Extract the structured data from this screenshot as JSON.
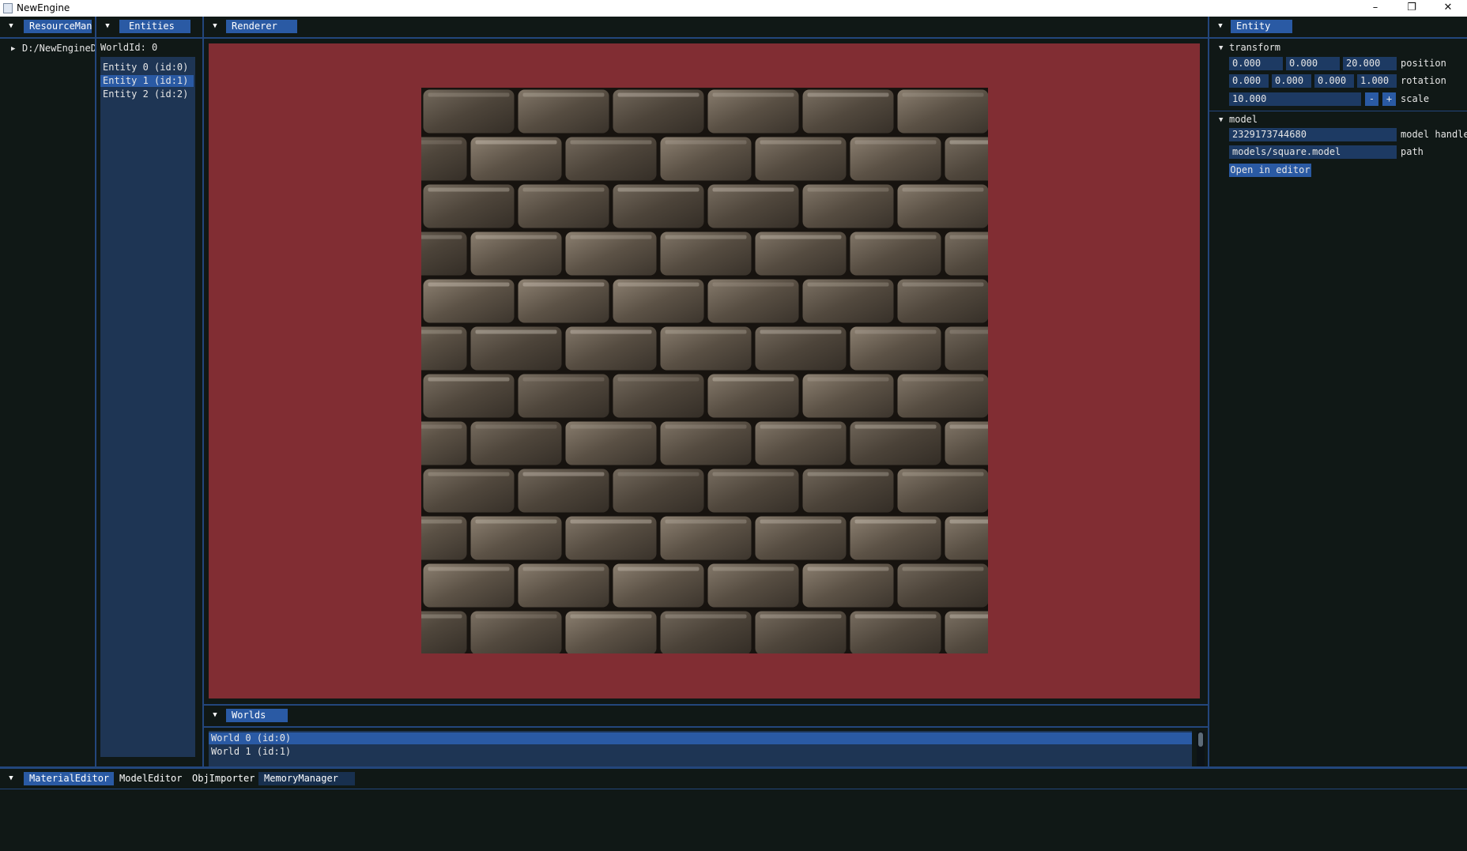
{
  "window": {
    "title": "NewEngine",
    "min": "–",
    "max": "❐",
    "close": "✕"
  },
  "resource_panel": {
    "tab": "ResourceMan",
    "tree_root": "D:/NewEngineD"
  },
  "entities_panel": {
    "tab": "Entities",
    "world_id": "WorldId: 0",
    "items": [
      "Entity 0 (id:0)",
      "Entity 1 (id:1)",
      "Entity 2 (id:2)"
    ],
    "selected": 1
  },
  "renderer_panel": {
    "tab": "Renderer",
    "clear_color": "#812d33",
    "texture": "stone-brick-wall"
  },
  "worlds_panel": {
    "tab": "Worlds",
    "items": [
      "World 0 (id:0)",
      "World 1 (id:1)"
    ],
    "selected": 0
  },
  "entity_panel": {
    "tab": "Entity",
    "transform": {
      "header": "transform",
      "position": [
        "0.000",
        "0.000",
        "20.000"
      ],
      "position_label": "position",
      "rotation": [
        "0.000",
        "0.000",
        "0.000",
        "1.000"
      ],
      "rotation_label": "rotation",
      "scale": "10.000",
      "scale_minus": "-",
      "scale_plus": "+",
      "scale_label": "scale"
    },
    "model": {
      "header": "model",
      "handle": "2329173744680",
      "handle_label": "model handle",
      "path": "models/square.model",
      "path_label": "path",
      "open_button": "Open in editor"
    }
  },
  "bottom_dock": {
    "tabs": [
      "MaterialEditor",
      "ModelEditor",
      "ObjImporter",
      "MemoryManager"
    ],
    "active": 0
  },
  "colors": {
    "accent": "#2a5aa4",
    "frame": "#101816",
    "field": "#1d3a63",
    "list": "#1e3554",
    "viewport": "#812d33"
  }
}
